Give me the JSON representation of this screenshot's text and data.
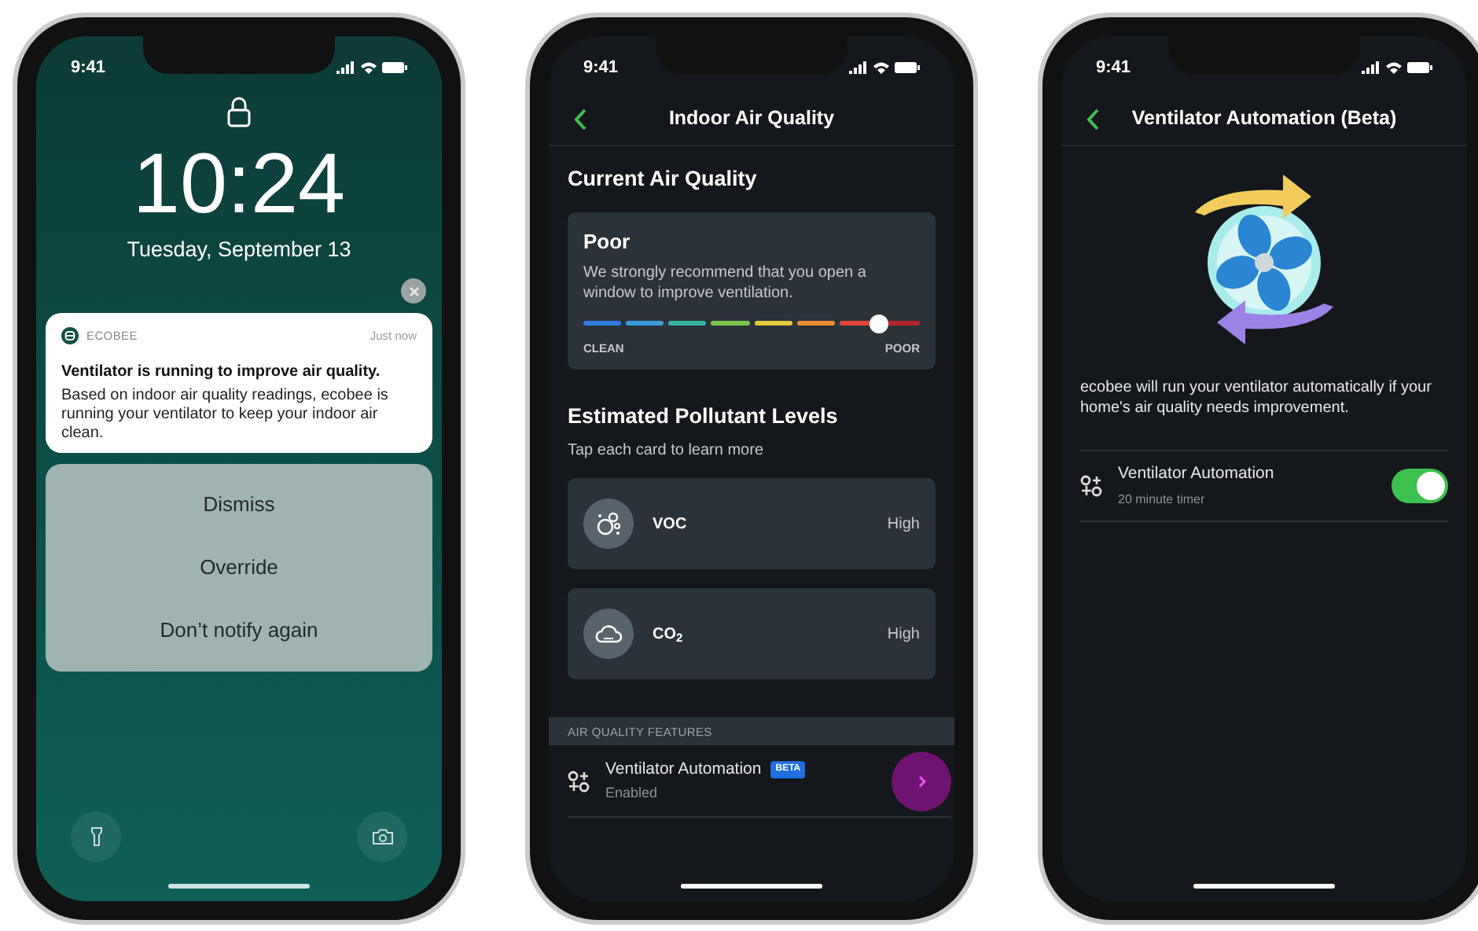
{
  "lock_screen": {
    "status_time": "9:41",
    "clock": "10:24",
    "date": "Tuesday, September 13",
    "notification": {
      "app": "ECOBEE",
      "time": "Just now",
      "title": "Ventilator is running to improve air quality.",
      "body": "Based on indoor air quality readings, ecobee is running your ventilator to keep your indoor air clean."
    },
    "actions": [
      "Dismiss",
      "Override",
      "Don’t notify again"
    ]
  },
  "air_quality_screen": {
    "status_time": "9:41",
    "title": "Indoor Air Quality",
    "section_title": "Current Air Quality",
    "quality_card": {
      "rating": "Poor",
      "message": "We strongly recommend that you open a window to improve ventilation.",
      "level": 0.88,
      "min_label": "CLEAN",
      "max_label": "POOR"
    },
    "pollutants_title": "Estimated Pollutant Levels",
    "pollutants_subtitle": "Tap each card to learn more",
    "pollutants": [
      {
        "kind": "voc",
        "name": "VOC",
        "value": "High"
      },
      {
        "kind": "co2",
        "name": "CO$_{2}$",
        "value": "High"
      }
    ],
    "features_header": "AIR QUALITY FEATURES",
    "feature": {
      "name": "Ventilator Automation",
      "badge": "BETA",
      "status": "Enabled"
    }
  },
  "automation_screen": {
    "status_time": "9:41",
    "title": "Ventilator Automation (Beta)",
    "description": "ecobee will run your ventilator automatically if your home's air quality needs improvement.",
    "setting": {
      "name": "Ventilator Automation",
      "detail": "20 minute timer",
      "on": true
    }
  }
}
